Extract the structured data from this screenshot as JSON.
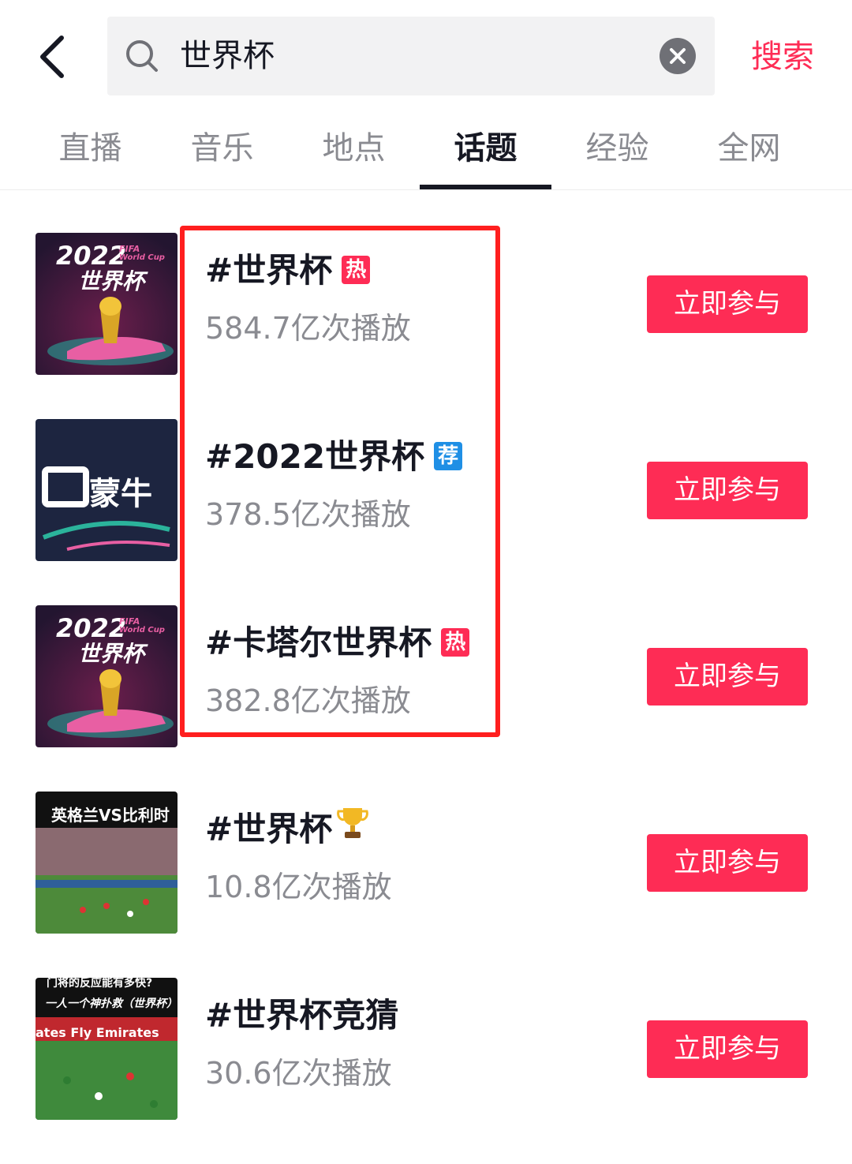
{
  "header": {
    "search_query": "世界杯",
    "search_button": "搜索"
  },
  "tabs": [
    {
      "label": "直播",
      "active": false
    },
    {
      "label": "音乐",
      "active": false
    },
    {
      "label": "地点",
      "active": false
    },
    {
      "label": "话题",
      "active": true
    },
    {
      "label": "经验",
      "active": false
    },
    {
      "label": "全网",
      "active": false
    }
  ],
  "topics": [
    {
      "title": "#世界杯",
      "tag": "热",
      "tag_color": "#fe2c55",
      "plays": "584.7亿次播放",
      "button": "立即参与",
      "thumb": "fifa-2022",
      "thumb_text": {
        "year": "2022",
        "brand": "FIFA",
        "sub": "World Cup",
        "name": "世界杯"
      }
    },
    {
      "title": "#2022世界杯",
      "tag": "荐",
      "tag_color": "#1f8fe5",
      "plays": "378.5亿次播放",
      "button": "立即参与",
      "thumb": "mengniu",
      "thumb_text": {
        "name": "蒙牛"
      }
    },
    {
      "title": "#卡塔尔世界杯",
      "tag": "热",
      "tag_color": "#fe2c55",
      "plays": "382.8亿次播放",
      "button": "立即参与",
      "thumb": "fifa-2022",
      "thumb_text": {
        "year": "2022",
        "brand": "FIFA",
        "sub": "World Cup",
        "name": "世界杯"
      }
    },
    {
      "title": "#世界杯",
      "tag": "",
      "icon": "trophy-icon",
      "plays": "10.8亿次播放",
      "button": "立即参与",
      "thumb": "match-england",
      "thumb_text": {
        "caption": "英格兰VS比利时"
      }
    },
    {
      "title": "#世界杯竞猜",
      "tag": "",
      "plays": "30.6亿次播放",
      "button": "立即参与",
      "thumb": "match-goalkeeper",
      "thumb_text": {
        "caption_top": "门将的反应能有多快?",
        "caption": "一人一个神扑救（世界杯）",
        "banner": "ates    Fly Emirates"
      }
    }
  ],
  "colors": {
    "accent": "#fe2c55",
    "highlight_border": "#ff1f1f",
    "recommend_tag": "#1f8fe5"
  }
}
